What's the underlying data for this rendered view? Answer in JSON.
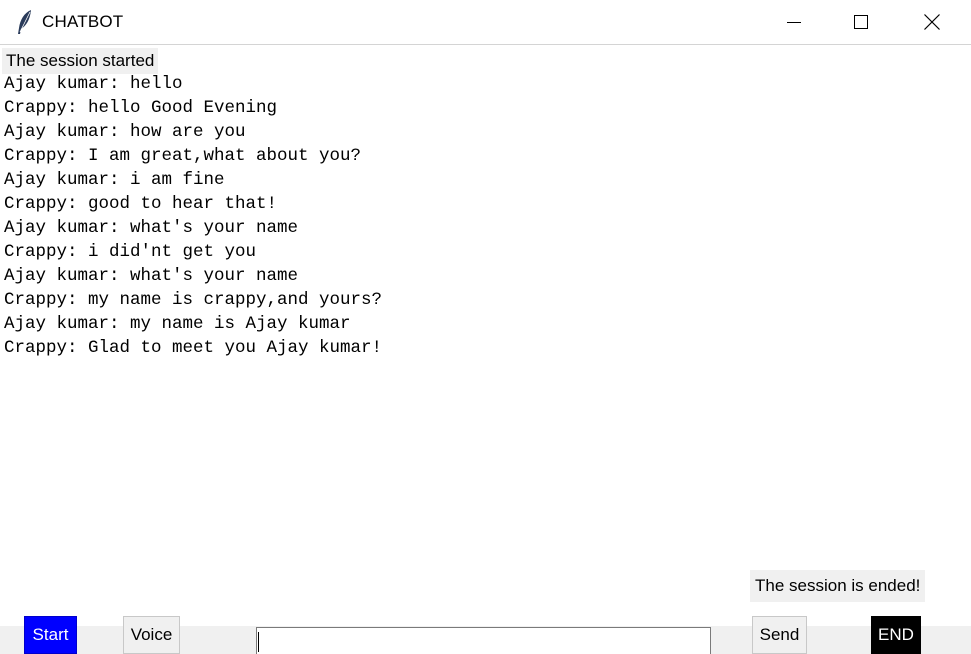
{
  "window": {
    "title": "CHATBOT",
    "controls": {
      "minimize": "minimize-icon",
      "maximize": "maximize-icon",
      "close": "close-icon"
    }
  },
  "status": {
    "started": "The session started",
    "ended": "The session is ended!"
  },
  "messages": [
    "Ajay kumar: hello",
    "Crappy: hello Good Evening",
    "Ajay kumar: how are you",
    "Crappy: I am great,what about you?",
    "Ajay kumar: i am fine",
    "Crappy: good to hear that!",
    "Ajay kumar: what's your name",
    "Crappy: i did'nt get you",
    "Ajay kumar: what's your name",
    "Crappy: my name is crappy,and yours?",
    "Ajay kumar: my name is Ajay kumar",
    "Crappy: Glad to meet you Ajay kumar!"
  ],
  "controls": {
    "start_label": "Start",
    "voice_label": "Voice",
    "send_label": "Send",
    "end_label": "END",
    "input_value": ""
  },
  "colors": {
    "start_button_bg": "#0000ff",
    "end_button_bg": "#000000"
  }
}
